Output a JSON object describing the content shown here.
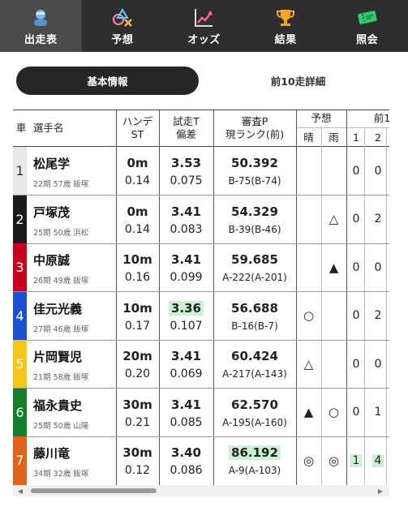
{
  "nav": [
    {
      "label": "出走表",
      "icon": "racer-icon",
      "active": true
    },
    {
      "label": "予想",
      "icon": "prediction-icon",
      "active": false
    },
    {
      "label": "オッズ",
      "icon": "odds-chart-icon",
      "active": false
    },
    {
      "label": "結果",
      "icon": "trophy-icon",
      "active": false
    },
    {
      "label": "照会",
      "icon": "ticket-icon",
      "active": false
    }
  ],
  "tabs": [
    "基本情報",
    "前10走詳細"
  ],
  "headers": {
    "car": "車",
    "name": "選手名",
    "hande_1": "ハンデ",
    "hande_2": "ST",
    "trial_1": "試走T",
    "trial_2": "偏差",
    "rank_1": "審査P",
    "rank_2": "現ランク(前)",
    "yoso": "予想",
    "sunny": "晴",
    "rain": "雨",
    "prev": "前1",
    "prev_1": "1",
    "prev_2": "2"
  },
  "rows": [
    {
      "car": "1",
      "car_bg": "#e8e8ec",
      "car_fg": "#333333",
      "name": "松尾学",
      "info": "22期 57歳 飯塚",
      "hande": "0m",
      "st": "0.14",
      "trial": "3.53",
      "dev": "0.075",
      "points": "50.392",
      "rank": "B-75(B-74)",
      "sunny": "",
      "rain": "",
      "p1": "0",
      "p2": "0",
      "trial_hl": false,
      "points_hl": false,
      "prev_hl": false
    },
    {
      "car": "2",
      "car_bg": "#1a1a1a",
      "car_fg": "#ffffff",
      "name": "戸塚茂",
      "info": "25期 50歳 浜松",
      "hande": "0m",
      "st": "0.14",
      "trial": "3.41",
      "dev": "0.083",
      "points": "54.329",
      "rank": "B-39(B-46)",
      "sunny": "",
      "rain": "△",
      "p1": "0",
      "p2": "2",
      "trial_hl": false,
      "points_hl": false,
      "prev_hl": false
    },
    {
      "car": "3",
      "car_bg": "#c8001e",
      "car_fg": "#ffffff",
      "name": "中原誠",
      "info": "26期 49歳 飯塚",
      "hande": "10m",
      "st": "0.16",
      "trial": "3.41",
      "dev": "0.099",
      "points": "59.685",
      "rank": "A-222(A-201)",
      "sunny": "",
      "rain": "▲",
      "p1": "0",
      "p2": "0",
      "trial_hl": false,
      "points_hl": false,
      "prev_hl": false
    },
    {
      "car": "4",
      "car_bg": "#1a4fd0",
      "car_fg": "#ffffff",
      "name": "佳元光義",
      "info": "27期 46歳 飯塚",
      "hande": "10m",
      "st": "0.17",
      "trial": "3.36",
      "dev": "0.107",
      "points": "56.688",
      "rank": "B-16(B-7)",
      "sunny": "○",
      "rain": "",
      "p1": "0",
      "p2": "2",
      "trial_hl": true,
      "points_hl": false,
      "prev_hl": false
    },
    {
      "car": "5",
      "car_bg": "#f5c518",
      "car_fg": "#ffffff",
      "name": "片岡賢児",
      "info": "21期 58歳 飯塚",
      "hande": "20m",
      "st": "0.20",
      "trial": "3.41",
      "dev": "0.069",
      "points": "60.424",
      "rank": "A-217(A-143)",
      "sunny": "△",
      "rain": "",
      "p1": "0",
      "p2": "0",
      "trial_hl": false,
      "points_hl": false,
      "prev_hl": false
    },
    {
      "car": "6",
      "car_bg": "#12802a",
      "car_fg": "#ffffff",
      "name": "福永貴史",
      "info": "25期 50歳 山陽",
      "hande": "30m",
      "st": "0.21",
      "trial": "3.41",
      "dev": "0.085",
      "points": "62.570",
      "rank": "A-195(A-160)",
      "sunny": "▲",
      "rain": "○",
      "p1": "0",
      "p2": "1",
      "trial_hl": false,
      "points_hl": false,
      "prev_hl": false
    },
    {
      "car": "7",
      "car_bg": "#e0641a",
      "car_fg": "#ffffff",
      "name": "藤川竜",
      "info": "34期 32歳 飯塚",
      "hande": "30m",
      "st": "0.12",
      "trial": "3.40",
      "dev": "0.086",
      "points": "86.192",
      "rank": "A-9(A-103)",
      "sunny": "◎",
      "rain": "◎",
      "p1": "1",
      "p2": "4",
      "trial_hl": false,
      "points_hl": true,
      "prev_hl": true
    }
  ]
}
